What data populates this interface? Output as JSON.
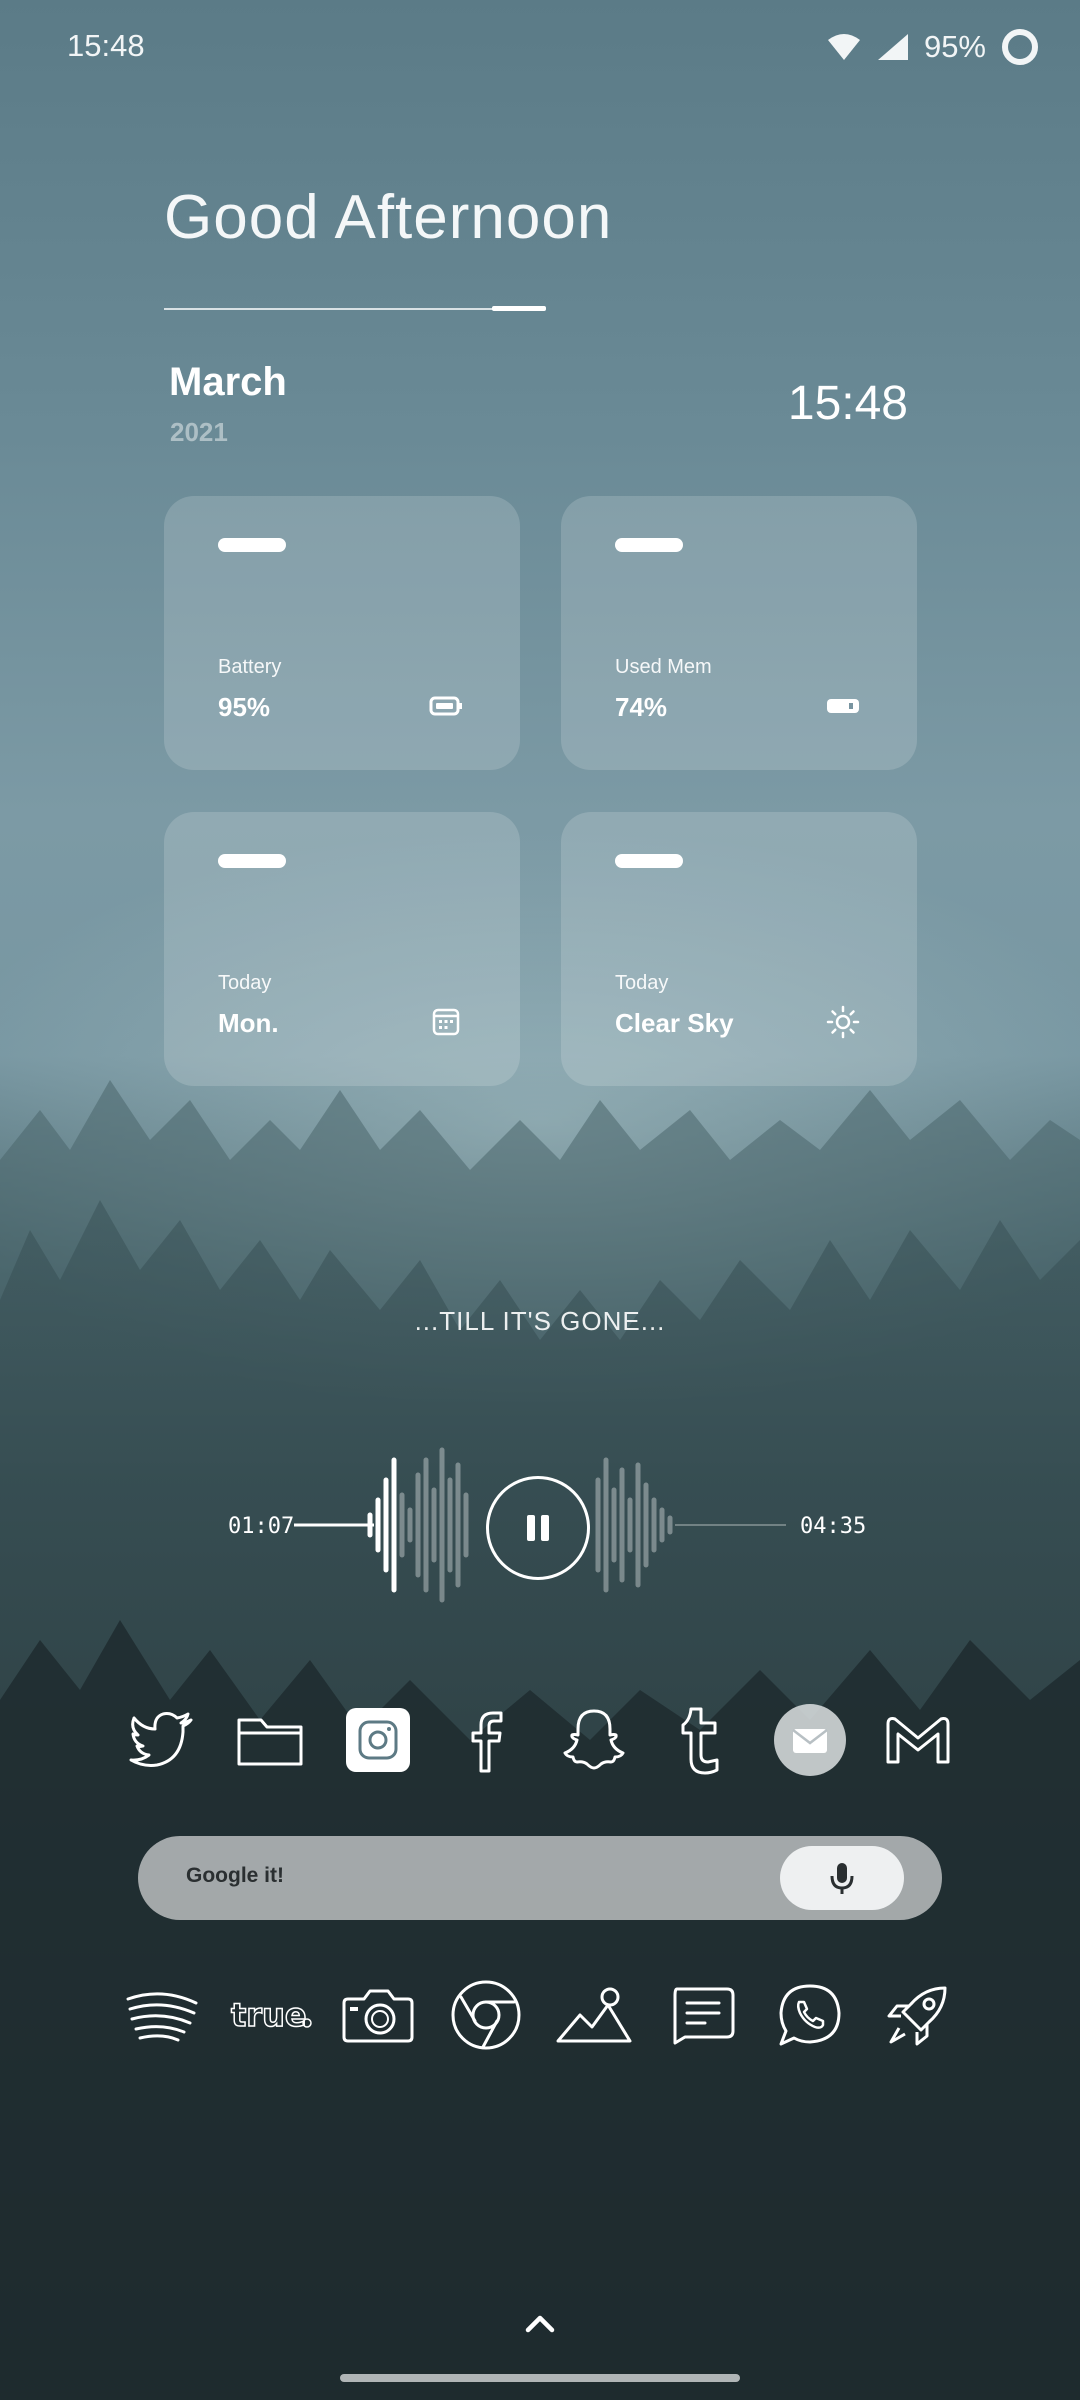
{
  "status_bar": {
    "time": "15:48",
    "battery_percent": "95%"
  },
  "greeting": "Good Afternoon",
  "date": {
    "month": "March",
    "year": "2021",
    "time": "15:48"
  },
  "cards": [
    {
      "label": "Battery",
      "value": "95%",
      "icon": "battery-icon"
    },
    {
      "label": "Used Mem",
      "value": "74%",
      "icon": "memory-icon"
    },
    {
      "label": "Today",
      "value": "Mon.",
      "icon": "calendar-icon"
    },
    {
      "label": "Today",
      "value": "Clear Sky",
      "icon": "sun-icon"
    }
  ],
  "music": {
    "title": "...TILL IT'S GONE...",
    "elapsed": "01:07",
    "duration": "04:35",
    "state": "playing"
  },
  "dock_top": [
    "twitter-icon",
    "folder-icon",
    "instagram-icon",
    "facebook-icon",
    "snapchat-icon",
    "tumblr-icon",
    "email-icon",
    "gmail-icon"
  ],
  "search": {
    "placeholder": "Google it!"
  },
  "dock_bottom": [
    "spotify-icon",
    "truecaller-icon",
    "camera-icon",
    "chrome-icon",
    "gallery-icon",
    "messages-icon",
    "whatsapp-icon",
    "rocket-launcher-icon"
  ],
  "dock_bottom_labels": {
    "truecaller": "true"
  },
  "colors": {
    "card": "#ffffff29",
    "search_bar": "#c8cacc",
    "accent": "#ffffff"
  }
}
